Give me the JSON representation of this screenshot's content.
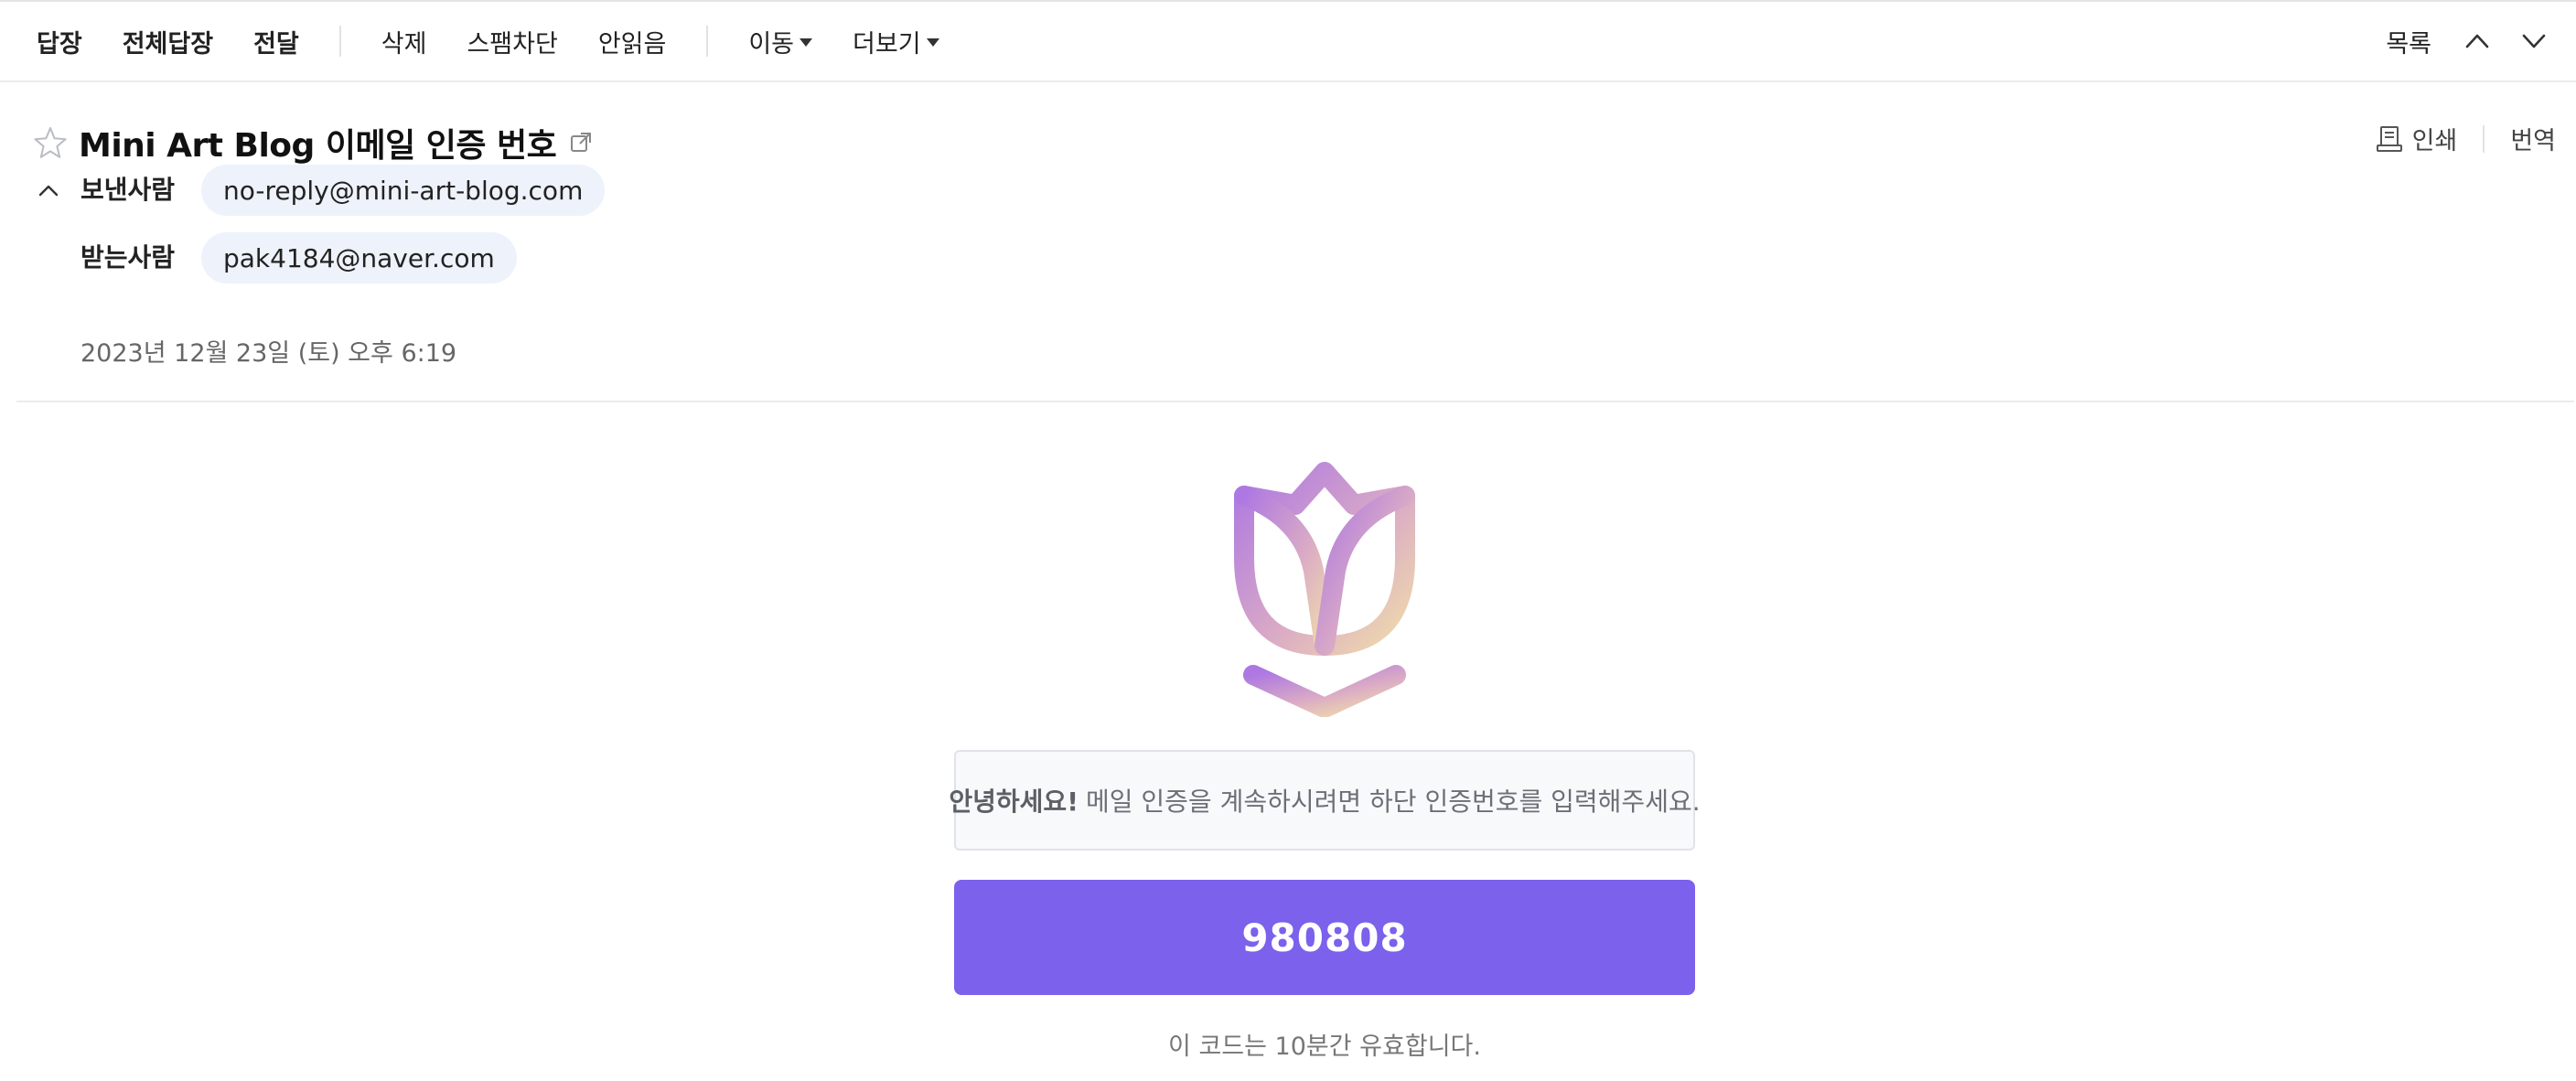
{
  "toolbar": {
    "reply": "답장",
    "reply_all": "전체답장",
    "forward": "전달",
    "delete": "삭제",
    "spam_block": "스팸차단",
    "unread": "안읽음",
    "move": "이동",
    "more": "더보기",
    "list": "목록"
  },
  "header": {
    "subject": "Mini Art Blog 이메일 인증 번호",
    "print": "인쇄",
    "translate": "번역",
    "from_label": "보낸사람",
    "from_address": "no-reply@mini-art-blog.com",
    "to_label": "받는사람",
    "to_address": "pak4184@naver.com",
    "date": "2023년 12월 23일 (토) 오후 6:19"
  },
  "body": {
    "greeting_strong": "안녕하세요!",
    "greeting_text": "메일 인증을 계속하시려면 하단 인증번호를 입력해주세요.",
    "code": "980808",
    "validity": "이 코드는 10분간 유효합니다.",
    "logo_icon": "tulip-icon",
    "code_bg_color": "#7b61ec",
    "logo_gradient": [
      "#b07ae0",
      "#f0dba8"
    ]
  }
}
